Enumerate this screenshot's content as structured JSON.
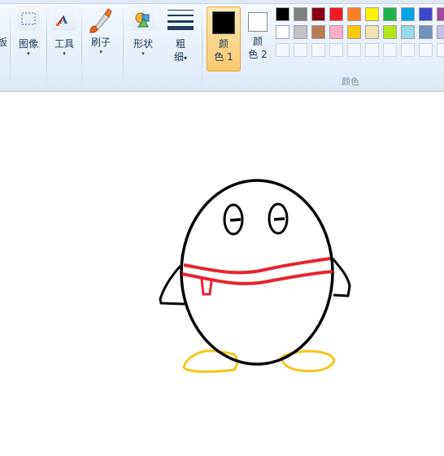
{
  "ribbon": {
    "clipboard_label": "板",
    "image_label": "图像",
    "tools_label": "工具",
    "brushes_label": "刷子",
    "shapes_label": "形状",
    "size_label_line1": "粗",
    "size_label_line2": "细",
    "color1_line1": "颜",
    "color1_line2": "色 1",
    "color2_line1": "颜",
    "color2_line2": "色 2",
    "colors_group_label": "颜色",
    "dropdown_arrow": "▾"
  },
  "palette": {
    "row1": [
      "#000000",
      "#7f7f7f",
      "#880015",
      "#ed1c24",
      "#ff7f27",
      "#fff200",
      "#22b14c",
      "#00a2e8",
      "#3f48cc",
      "#a349a4"
    ],
    "row2": [
      "#ffffff",
      "#c3c3c3",
      "#b97a57",
      "#ffaec9",
      "#ffc90e",
      "#efe4b0",
      "#b5e61d",
      "#99d9ea",
      "#7092be",
      "#c8bfe7"
    ],
    "row3_empty_count": 10
  },
  "colors": {
    "color1": "#000000",
    "color2": "#ffffff",
    "drawing_outline": "#000000",
    "scarf": "#e8232e",
    "feet": "#f5c518"
  }
}
